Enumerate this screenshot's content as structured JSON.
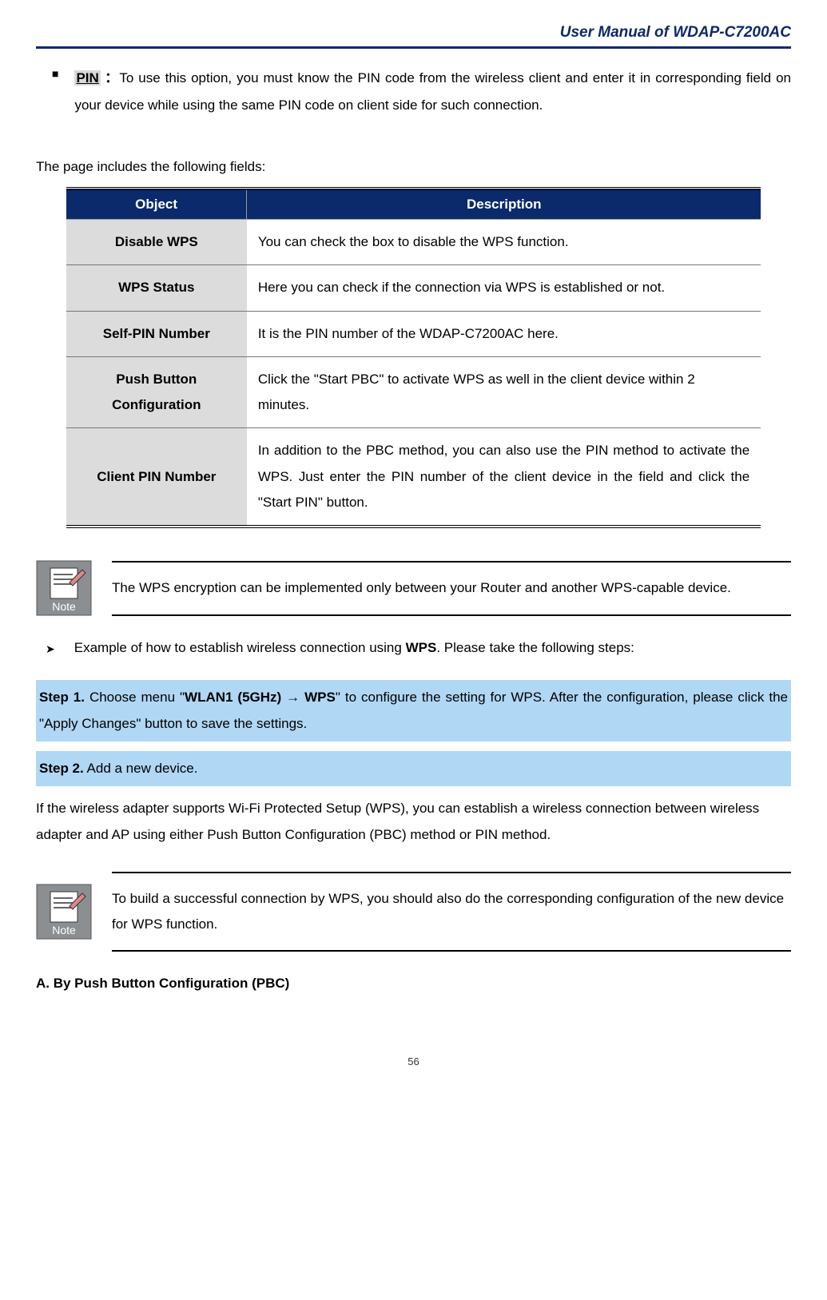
{
  "header": {
    "title": "User Manual of WDAP-C7200AC"
  },
  "pin": {
    "label": "PIN",
    "colon": "：",
    "text": "To use this option, you must know the PIN code from the wireless client and enter it in corresponding field on your device while using the same PIN code on client side for such connection."
  },
  "fields_intro": "The page includes the following fields:",
  "table": {
    "head_object": "Object",
    "head_description": "Description",
    "rows": [
      {
        "object": "Disable WPS",
        "desc": "You can check the box to disable the WPS function."
      },
      {
        "object": "WPS Status",
        "desc": "Here you can check if the connection via WPS is established or not."
      },
      {
        "object": "Self-PIN Number",
        "desc": "It is the PIN number of the WDAP-C7200AC here."
      },
      {
        "object": "Push Button Configuration",
        "desc": "Click the \"Start PBC\" to activate WPS as well in the client device within 2 minutes."
      },
      {
        "object": "Client PIN Number",
        "desc": "In addition to the PBC method, you can also use the PIN method to activate the WPS. Just enter the PIN number of the client device in the field and click the \"Start PIN\" button."
      }
    ]
  },
  "note1": "The WPS encryption can be implemented only between your Router and another WPS-capable device.",
  "example_prefix": "Example of how to establish wireless connection using ",
  "example_bold": "WPS",
  "example_suffix": ". Please take the following steps:",
  "step1": {
    "num": "Step 1.",
    "p1": " Choose menu \"",
    "menu": "WLAN1 (5GHz) → WPS",
    "p2": "\" to configure the setting for WPS. After the configuration, please click the \"Apply Changes\" button to save the settings."
  },
  "step2": {
    "num": "Step 2.",
    "text": " Add a new device."
  },
  "after_step2": "If the wireless adapter supports Wi-Fi Protected Setup (WPS), you can establish a wireless connection between wireless adapter and AP using either Push Button Configuration (PBC) method or PIN method.",
  "note2": "To build a successful connection by WPS, you should also do the corresponding configuration of the new device for WPS function.",
  "section_a": "A.    By Push Button Configuration (PBC)",
  "page_number": "56",
  "note_label": "Note"
}
